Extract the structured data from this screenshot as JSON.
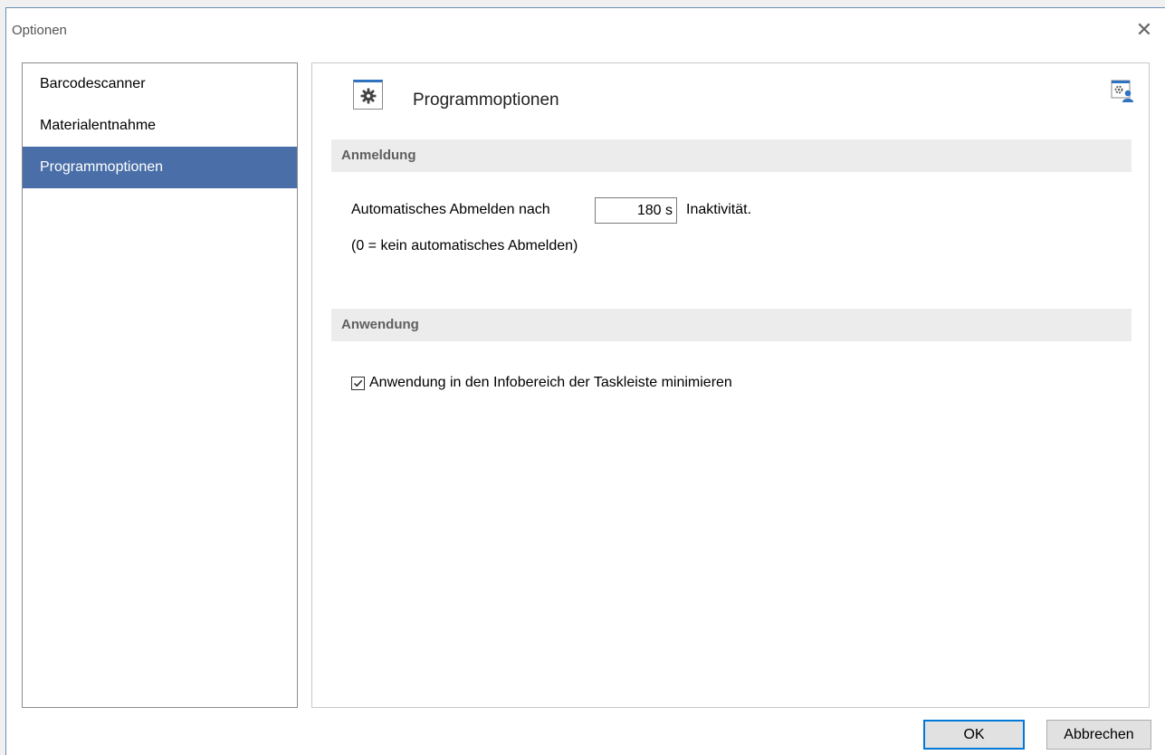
{
  "window": {
    "title": "Optionen"
  },
  "nav": {
    "items": [
      {
        "label": "Barcodescanner",
        "selected": false
      },
      {
        "label": "Materialentnahme",
        "selected": false
      },
      {
        "label": "Programmoptionen",
        "selected": true
      }
    ]
  },
  "content": {
    "title": "Programmoptionen",
    "sections": {
      "login": {
        "header": "Anmeldung",
        "prefix": "Automatisches Abmelden nach",
        "timeout_value": "180 s",
        "suffix": "Inaktivität.",
        "hint": "(0 = kein automatisches Abmelden)"
      },
      "app": {
        "header": "Anwendung",
        "checkbox_label": "Anwendung in den Infobereich der Taskleiste minimieren",
        "checked": true
      }
    }
  },
  "buttons": {
    "ok": "OK",
    "cancel": "Abbrechen"
  },
  "icons": {
    "header": "gear-icon",
    "corner": "user-settings-icon",
    "close": "close-icon"
  },
  "colors": {
    "selection": "#4a6fa8",
    "accent": "#2f73c0",
    "default_button_border": "#0078d7"
  }
}
